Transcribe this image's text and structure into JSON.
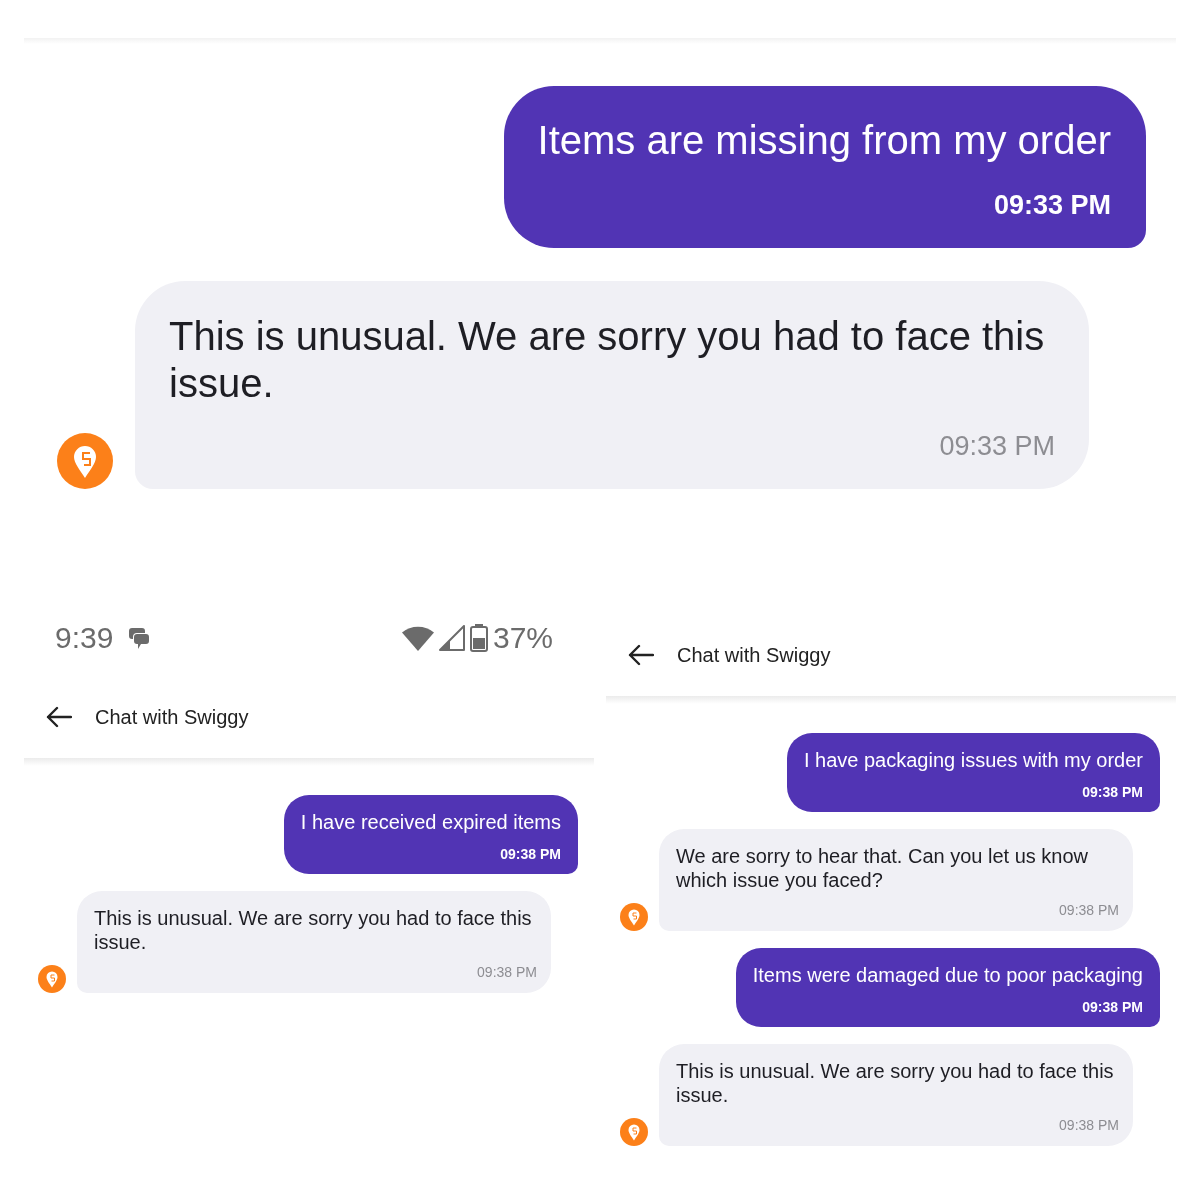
{
  "panels": [
    {
      "kind": "zoomed",
      "messages": [
        {
          "kind": "sent",
          "text": "Items are missing from my order",
          "time": "09:33 PM"
        },
        {
          "kind": "received",
          "text": "This is unusual. We are sorry you had to face this issue.",
          "time": "09:33 PM"
        }
      ]
    },
    {
      "kind": "phone",
      "status_bar": {
        "time": "9:39",
        "battery": "37%"
      },
      "header": {
        "title": "Chat with Swiggy"
      },
      "messages": [
        {
          "kind": "sent",
          "text": "I have received expired items",
          "time": "09:38 PM"
        },
        {
          "kind": "received",
          "text": "This is unusual. We are sorry you had to face this issue.",
          "time": "09:38 PM"
        }
      ]
    },
    {
      "kind": "phone",
      "header": {
        "title": "Chat with Swiggy"
      },
      "messages": [
        {
          "kind": "sent",
          "text": "I have packaging issues with my order",
          "time": "09:38 PM"
        },
        {
          "kind": "received",
          "text": "We are sorry to hear that. Can you let us know which issue you faced?",
          "time": "09:38 PM"
        },
        {
          "kind": "sent",
          "text": "Items were damaged due to poor packaging",
          "time": "09:38 PM"
        },
        {
          "kind": "received",
          "text": "This is unusual. We are sorry you had to face this issue.",
          "time": "09:38 PM"
        }
      ]
    }
  ]
}
